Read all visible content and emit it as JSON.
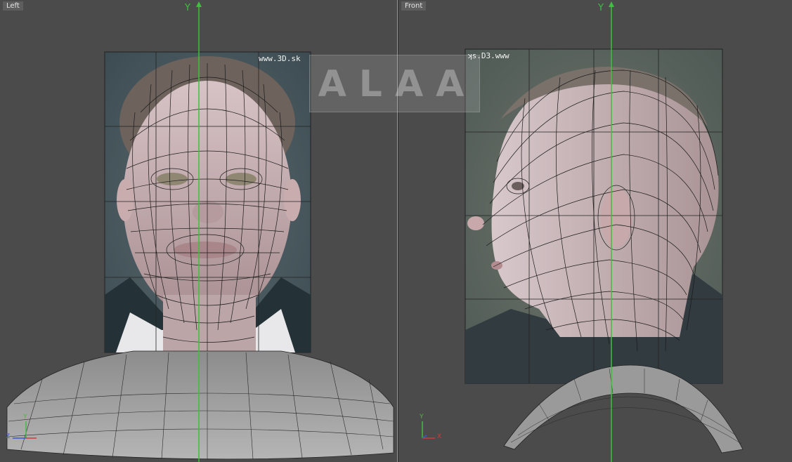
{
  "viewports": {
    "left": {
      "label": "Left",
      "y_axis": "Y"
    },
    "right": {
      "label": "Front",
      "y_axis": "Y"
    }
  },
  "photo_text": {
    "left": "www.3D.sk",
    "right": "ʞs.D3.www"
  },
  "watermark": "ALAA",
  "gizmo": {
    "y": "Y",
    "z": "Z",
    "x": "X"
  },
  "colors": {
    "viewport_bg": "#4b4b4b",
    "axis_green": "#3fbf3f",
    "axis_red": "#d23a3a",
    "axis_blue": "#3a5ad2",
    "wire": "#1a1a1a"
  }
}
